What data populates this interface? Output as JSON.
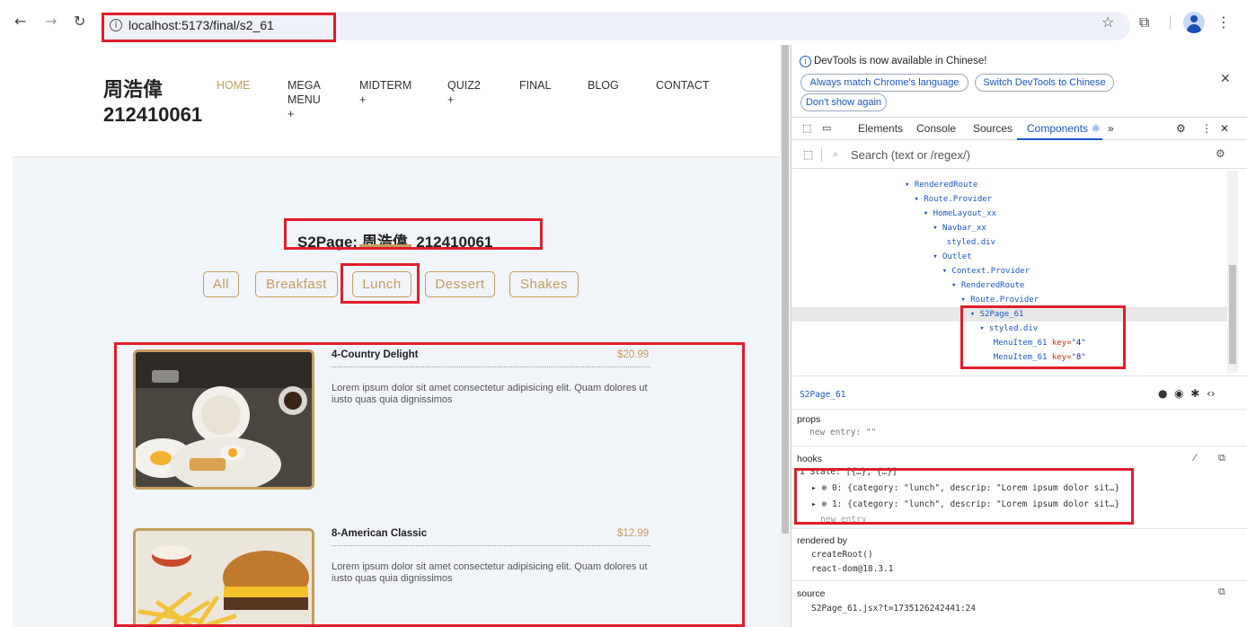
{
  "browser": {
    "url": "localhost:5173/final/s2_61",
    "back_icon": "back-arrow-icon",
    "forward_icon": "forward-arrow-icon",
    "reload_icon": "reload-icon",
    "star_icon": "star-icon",
    "extensions_icon": "puzzle-icon",
    "menu_icon": "kebab-menu-icon"
  },
  "site": {
    "brand_line1": "周浩偉",
    "brand_line2": "212410061",
    "menu": [
      {
        "label": "HOME",
        "active": true
      },
      {
        "label": "MEGA\nMENU\n+"
      },
      {
        "label": "MIDTERM\n+"
      },
      {
        "label": "QUIZ2\n+"
      },
      {
        "label": "FINAL"
      },
      {
        "label": "BLOG"
      },
      {
        "label": "CONTACT"
      }
    ],
    "page_title": "S2Page: 周浩偉, 212410061",
    "filters": [
      "All",
      "Breakfast",
      "Lunch",
      "Dessert",
      "Shakes"
    ],
    "items": [
      {
        "name": "4-Country Delight",
        "price": "$20.99",
        "desc": "Lorem ipsum dolor sit amet consectetur adipisicing elit. Quam dolores ut iusto quas quia dignissimos"
      },
      {
        "name": "8-American Classic",
        "price": "$12.99",
        "desc": "Lorem ipsum dolor sit amet consectetur adipisicing elit. Quam dolores ut iusto quas quia dignissimos"
      }
    ]
  },
  "devtools": {
    "info_text": "DevTools is now available in Chinese!",
    "btn_match": "Always match Chrome's language",
    "btn_switch": "Switch DevTools to Chinese",
    "btn_dont_show": "Don't show again",
    "tabs": [
      "Elements",
      "Console",
      "Sources",
      "Components ⚛",
      "»"
    ],
    "search_placeholder": "Search (text or /regex/)",
    "tree": [
      {
        "label": "▾ RenderedRoute",
        "indent": 0
      },
      {
        "label": "▾ Route.Provider",
        "indent": 1
      },
      {
        "label": "▾ HomeLayout_xx",
        "indent": 2
      },
      {
        "label": "▾ Navbar_xx",
        "indent": 3
      },
      {
        "label": "styled.div",
        "indent": 4.5
      },
      {
        "label": "▾ Outlet",
        "indent": 3
      },
      {
        "label": "▾ Context.Provider",
        "indent": 4
      },
      {
        "label": "▾ RenderedRoute",
        "indent": 5
      },
      {
        "label": "▾ Route.Provider",
        "indent": 6
      },
      {
        "label": "▾ S2Page_61",
        "indent": 7,
        "selected": true
      },
      {
        "label": "▾ styled.div",
        "indent": 8
      },
      {
        "label": "MenuItem_61",
        "indent": 9.5,
        "key": "4"
      },
      {
        "label": "MenuItem_61",
        "indent": 9.5,
        "key": "8"
      }
    ],
    "selected_component": "S2Page_61",
    "props_label": "props",
    "props_new_entry": "new entry: \"\"",
    "hooks_label": "hooks",
    "hook_state": "1 State: [{…}, {…}]",
    "hook_items": [
      "0: {category: \"lunch\", descrip: \"Lorem ipsum dolor sit…}",
      "1: {category: \"lunch\", descrip: \"Lorem ipsum dolor sit…}"
    ],
    "hook_new_entry": "new entry",
    "rendered_by_label": "rendered by",
    "rendered_by": [
      "createRoot()",
      "react-dom@18.3.1"
    ],
    "source_label": "source",
    "source_value": "S2Page_61.jsx?t=1735126242441:24"
  }
}
